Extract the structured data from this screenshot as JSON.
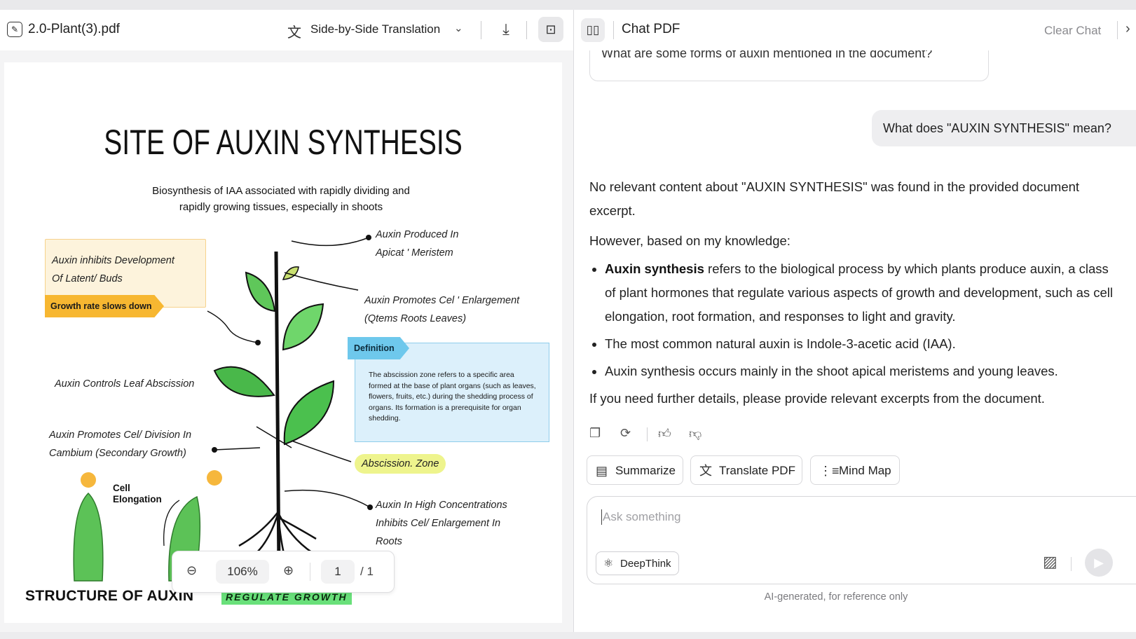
{
  "doc_toolbar": {
    "filename": "2.0-Plant(3).pdf",
    "translate_label": "Side-by-Side Translation"
  },
  "pdf_page": {
    "title": "SITE OF AUXIN SYNTHESIS",
    "subtitle_line1": "Biosynthesis of IAA associated with rapidly dividing and",
    "subtitle_line2": "rapidly growing tissues, especially in shoots",
    "ann_inhibits_1": "Auxin inhibits Development",
    "ann_inhibits_2": "Of Latent/ Buds",
    "growth_tag": "Growth rate slows down",
    "ann_produced_1": "Auxin Produced In",
    "ann_produced_2": "Apicat ' Meristem",
    "ann_promotes_1": "Auxin Promotes Cel ' Enlargement",
    "ann_promotes_2": "(Qtems Roots Leaves)",
    "definition_tag": "Definition",
    "definition_text": "The abscission zone refers to a specific area formed at the base of plant organs (such as leaves, flowers, fruits, etc.) during the shedding process of organs. Its formation is a prerequisite for organ shedding.",
    "ann_leaf": "Auxin Controls Leaf Abscission",
    "ann_cambium_1": "Auxin Promotes Cel/ Division In",
    "ann_cambium_2": "Cambium (Secondary Growth)",
    "abscission_zone": "Abscission. Zone",
    "cell_elong_1": "Cell",
    "cell_elong_2": "Elongation",
    "ann_high_1": "Auxin In High Concentrations",
    "ann_high_2": "Inhibits Cel/ Enlargement In",
    "ann_high_3": "Roots",
    "structure": "STRUCTURE OF AUXIN",
    "regulate": "REGULATE GROWTH"
  },
  "zoombar": {
    "zoom": "106%",
    "page": "1",
    "total": "/ 1"
  },
  "chat": {
    "title": "Chat PDF",
    "clear": "Clear Chat",
    "prev_question": "What are some forms of auxin mentioned in the document?",
    "user_question": "What does \"AUXIN SYNTHESIS\" mean?",
    "answer_p1": "No relevant content about \"AUXIN SYNTHESIS\" was found in the provided document excerpt.",
    "answer_p2": "However, based on my knowledge:",
    "bullet1_bold": "Auxin synthesis",
    "bullet1_rest": " refers to the biological process by which plants produce auxin, a class of plant hormones that regulate various aspects of growth and development, such as cell elongation, root formation, and responses to light and gravity.",
    "bullet2": "The most common natural auxin is Indole-3-acetic acid (IAA).",
    "bullet3": "Auxin synthesis occurs mainly in the shoot apical meristems and young leaves.",
    "answer_p3": "If you need further details, please provide relevant excerpts from the document.",
    "chips": {
      "summarize": "Summarize",
      "translate": "Translate PDF",
      "mindmap": "Mind Map"
    },
    "input_placeholder": "Ask something",
    "deepthink": "DeepThink",
    "disclaimer": "AI-generated, for reference only"
  },
  "icons": [
    "pdf-file-icon",
    "translate-icon",
    "chevron-down-icon",
    "download-icon",
    "ai-assistant-icon",
    "book-icon",
    "close-chevron-icon",
    "zoom-out-icon",
    "zoom-in-icon",
    "copy-icon",
    "regenerate-icon",
    "thumbs-up-icon",
    "thumbs-down-icon",
    "summarize-icon",
    "translate-pdf-icon",
    "mind-map-icon",
    "deepthink-icon",
    "image-upload-icon",
    "send-icon"
  ]
}
